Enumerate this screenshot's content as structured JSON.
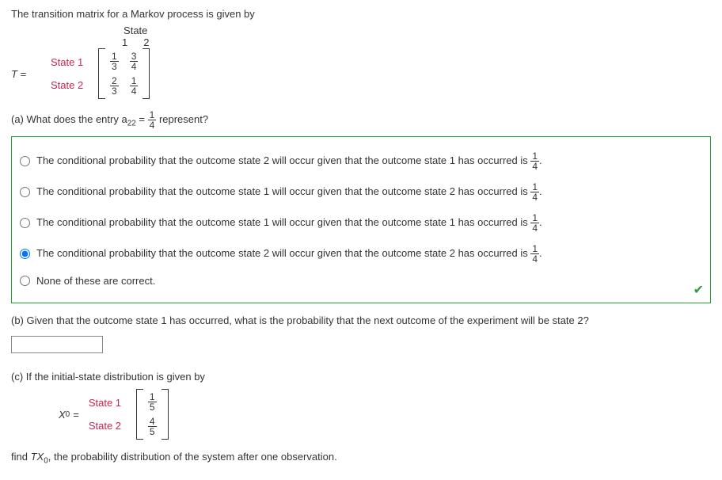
{
  "intro": "The transition matrix for a Markov process is given by",
  "matrixT": {
    "lhs": "T =",
    "headerLabel": "State",
    "colNums": [
      "1",
      "2"
    ],
    "rowLabels": [
      "State 1",
      "State 2"
    ],
    "cells": [
      [
        {
          "n": "1",
          "d": "3"
        },
        {
          "n": "3",
          "d": "4"
        }
      ],
      [
        {
          "n": "2",
          "d": "3"
        },
        {
          "n": "1",
          "d": "4"
        }
      ]
    ]
  },
  "partA": {
    "prefix": "(a) What does the entry a",
    "sub": "22",
    "mid": " = ",
    "frac": {
      "n": "1",
      "d": "4"
    },
    "suffix": " represent?"
  },
  "options": [
    {
      "text": "The conditional probability that the outcome state 2 will occur given that the outcome state 1 has occurred is ",
      "frac": {
        "n": "1",
        "d": "4"
      },
      "tail": ".",
      "checked": false
    },
    {
      "text": "The conditional probability that the outcome state 1 will occur given that the outcome state 2 has occurred is ",
      "frac": {
        "n": "1",
        "d": "4"
      },
      "tail": ".",
      "checked": false
    },
    {
      "text": "The conditional probability that the outcome state 1 will occur given that the outcome state 1 has occurred is ",
      "frac": {
        "n": "1",
        "d": "4"
      },
      "tail": ".",
      "checked": false
    },
    {
      "text": "The conditional probability that the outcome state 2 will occur given that the outcome state 2 has occurred is ",
      "frac": {
        "n": "1",
        "d": "4"
      },
      "tail": ".",
      "checked": true
    },
    {
      "text": "None of these are correct.",
      "frac": null,
      "tail": "",
      "checked": false
    }
  ],
  "partB": {
    "text": "(b) Given that the outcome state 1 has occurred, what is the probability that the next outcome of the experiment will be state 2?",
    "value": ""
  },
  "partC": {
    "text": "(c) If the initial-state distribution is given by",
    "lhs": "X",
    "lhsSub": "0",
    "eq": " = ",
    "rowLabels": [
      "State 1",
      "State 2"
    ],
    "cells": [
      [
        {
          "n": "1",
          "d": "5"
        }
      ],
      [
        {
          "n": "4",
          "d": "5"
        }
      ]
    ],
    "trailerPrefix": "find ",
    "trailerItalic1": "TX",
    "trailerSub": "0",
    "trailerSuffix": ", the probability distribution of the system after one observation."
  }
}
